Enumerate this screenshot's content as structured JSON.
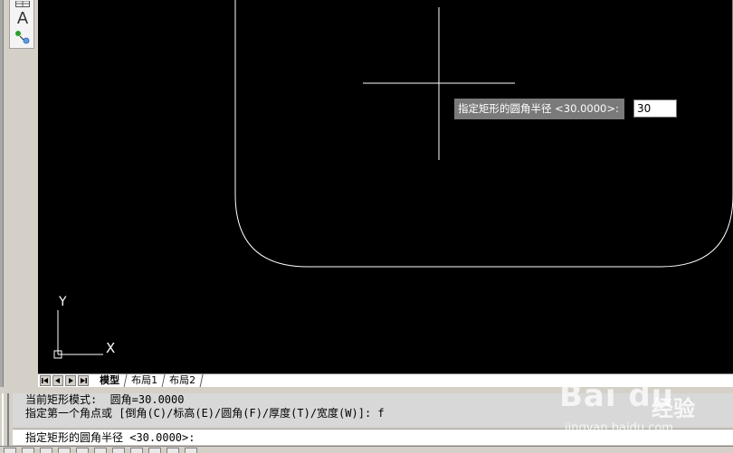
{
  "toolbar": {
    "text_tool_glyph": "A",
    "icons": [
      "table-icon",
      "multiline-text-icon",
      "point-pick-icon"
    ]
  },
  "viewport": {
    "background": "#000000",
    "rectangle_stroke": "#ffffff",
    "dynamic_input": {
      "prompt": "指定矩形的圆角半径 <30.0000>:",
      "value": "30"
    },
    "ucs": {
      "x_label": "X",
      "y_label": "Y"
    }
  },
  "layout_tabs": {
    "nav_buttons": [
      "first",
      "previous",
      "next",
      "last"
    ],
    "tabs": [
      {
        "label": "模型",
        "active": true
      },
      {
        "label": "布局1",
        "active": false
      },
      {
        "label": "布局2",
        "active": false
      }
    ]
  },
  "command_window": {
    "history": [
      "当前矩形模式:  圆角=30.0000",
      "指定第一个角点或 [倒角(C)/标高(E)/圆角(F)/厚度(T)/宽度(W)]: f"
    ],
    "current_prompt": "指定矩形的圆角半径 <30.0000>:"
  },
  "watermark": {
    "logo": "Bai du",
    "text": "经验",
    "url": "jingyan.baidu.com"
  }
}
